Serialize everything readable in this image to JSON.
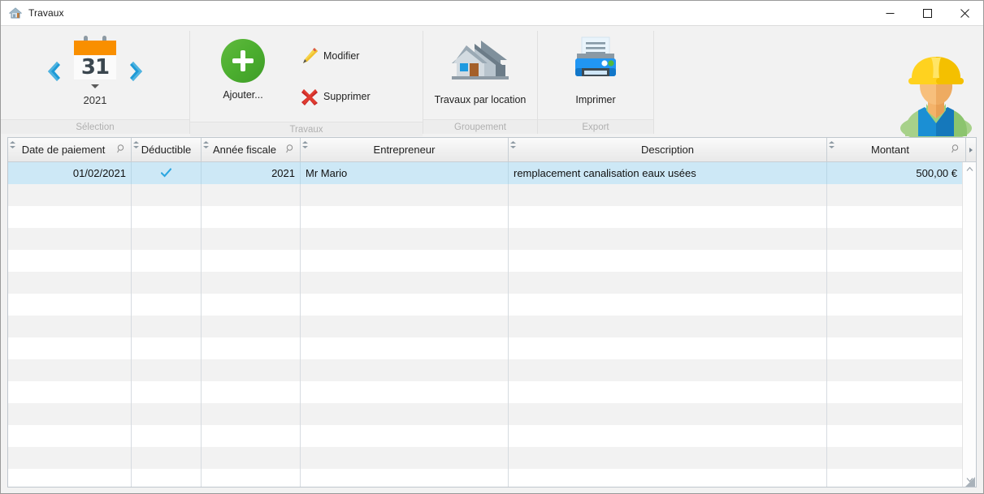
{
  "window": {
    "title": "Travaux",
    "title_icon": "house-icon",
    "minimize": "—",
    "maximize": "☐",
    "close": "✕"
  },
  "ribbon": {
    "groups": [
      {
        "label": "Sélection"
      },
      {
        "label": "Travaux"
      },
      {
        "label": "Groupement"
      },
      {
        "label": "Export"
      }
    ],
    "selection": {
      "prev_icon": "chevron-left-icon",
      "next_icon": "chevron-right-icon",
      "calendar_icon": "calendar-icon",
      "calendar_day": "31",
      "year": "2021"
    },
    "travaux": {
      "add_label": "Ajouter...",
      "add_icon": "plus-circle-icon",
      "edit_label": "Modifier",
      "edit_icon": "pencil-icon",
      "delete_label": "Supprimer",
      "delete_icon": "red-cross-icon"
    },
    "groupement": {
      "by_location_label": "Travaux par location",
      "by_location_icon": "houses-icon"
    },
    "export": {
      "print_label": "Imprimer",
      "print_icon": "printer-icon"
    },
    "avatar_icon": "construction-worker-avatar"
  },
  "grid": {
    "columns": [
      {
        "label": "Date de paiement",
        "filter": true,
        "align": "right"
      },
      {
        "label": "Déductible",
        "filter": false,
        "align": "center"
      },
      {
        "label": "Année fiscale",
        "filter": true,
        "align": "right"
      },
      {
        "label": "Entrepreneur",
        "filter": false,
        "align": "left"
      },
      {
        "label": "Description",
        "filter": false,
        "align": "left"
      },
      {
        "label": "Montant",
        "filter": true,
        "align": "right"
      }
    ],
    "rows": [
      {
        "date": "01/02/2021",
        "deductible": true,
        "fiscal_year": "2021",
        "contractor": "Mr Mario",
        "description": "remplacement canalisation eaux usées",
        "amount": "500,00 €"
      }
    ],
    "empty_row_count": 14,
    "scroll_up_icon": "chevron-up-icon",
    "scroll_down_icon": "chevron-down-icon",
    "column_menu_icon": "chevron-right-small-icon",
    "resize-grip": "resize-grip-icon"
  },
  "colors": {
    "accent_orange": "#f98f00",
    "accent_green": "#4caf2f",
    "accent_blue": "#1e9ad6",
    "selection_blue": "#cde8f6",
    "alt_row": "#f2f2f2"
  }
}
